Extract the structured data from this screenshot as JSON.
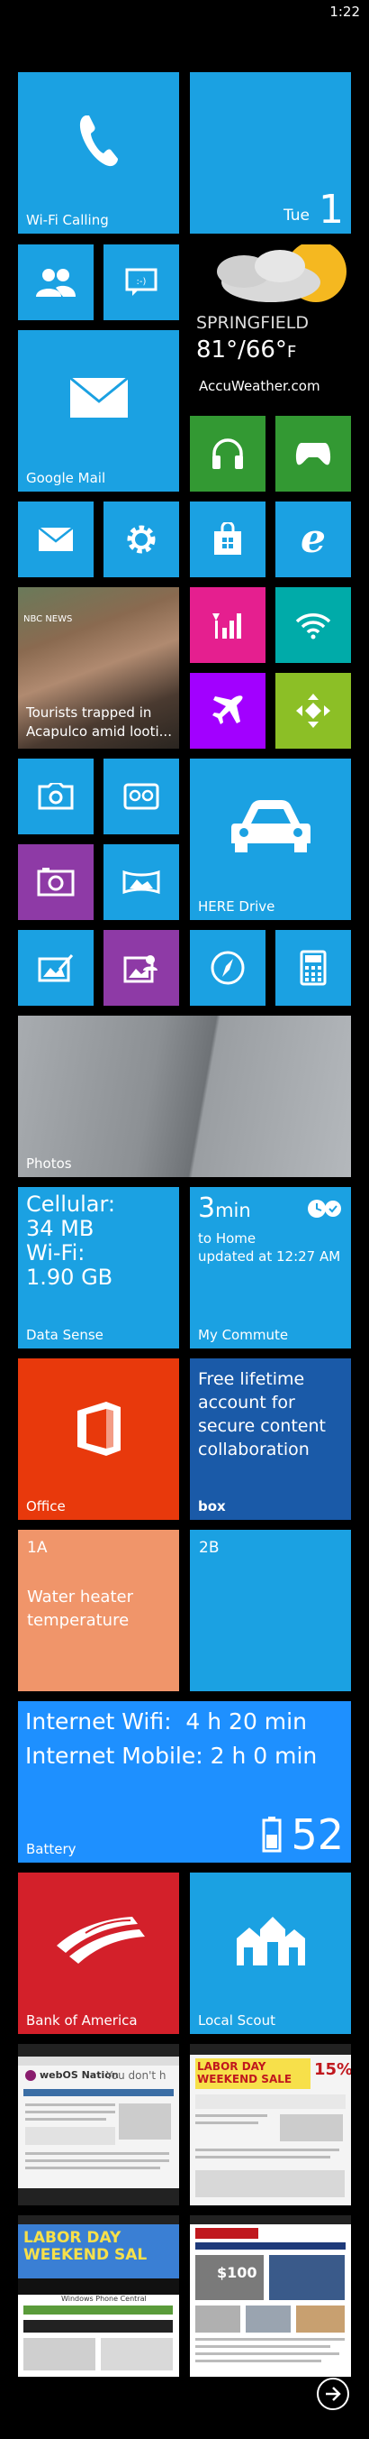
{
  "status": {
    "time": "1:22"
  },
  "tiles": {
    "wifi_calling": {
      "label": "Wi-Fi Calling"
    },
    "calendar": {
      "day": "Tue",
      "date": "1"
    },
    "weather": {
      "city": "SPRINGFIELD",
      "temp": "81°/66°",
      "unit": "F",
      "source": "AccuWeather.com"
    },
    "google_mail": {
      "label": "Google Mail"
    },
    "news": {
      "caption": "Tourists trapped in Acapulco  amid looti...",
      "source": "NBC NEWS"
    },
    "here_drive": {
      "label": "HERE Drive"
    },
    "photos": {
      "label": "Photos"
    },
    "data_sense": {
      "line1": "Cellular:",
      "line2": "34 MB",
      "line3": "Wi-Fi:",
      "line4": "1.90 GB",
      "label": "Data Sense"
    },
    "commute": {
      "minutes": "3",
      "unit": "min",
      "to": "to Home",
      "updated": "updated at 12:27 AM",
      "label": "My Commute"
    },
    "office": {
      "label": "Office"
    },
    "box": {
      "text": "Free lifetime account for secure content collaboration",
      "label": "box"
    },
    "note_1a": {
      "title": "1A",
      "text": "Water heater temperature"
    },
    "note_2b": {
      "title": "2B"
    },
    "battery": {
      "line1": "Internet Wifi:  4 h 20 min",
      "line2": "Internet Mobile: 2 h 0 min",
      "percent": "52",
      "label": "Battery"
    },
    "bank": {
      "label": "Bank of America"
    },
    "local_scout": {
      "label": "Local Scout"
    },
    "web1": {
      "title": "webOS Nation",
      "subtitle": "You don't h"
    },
    "web2": {
      "headline": "LABOR DAY WEEKEND SALE",
      "badge": "15%"
    },
    "web3": {
      "headline": "LABOR DAY WEEKEND SAL",
      "site": "Windows Phone Central"
    },
    "web4": {
      "badge": "$100"
    }
  }
}
